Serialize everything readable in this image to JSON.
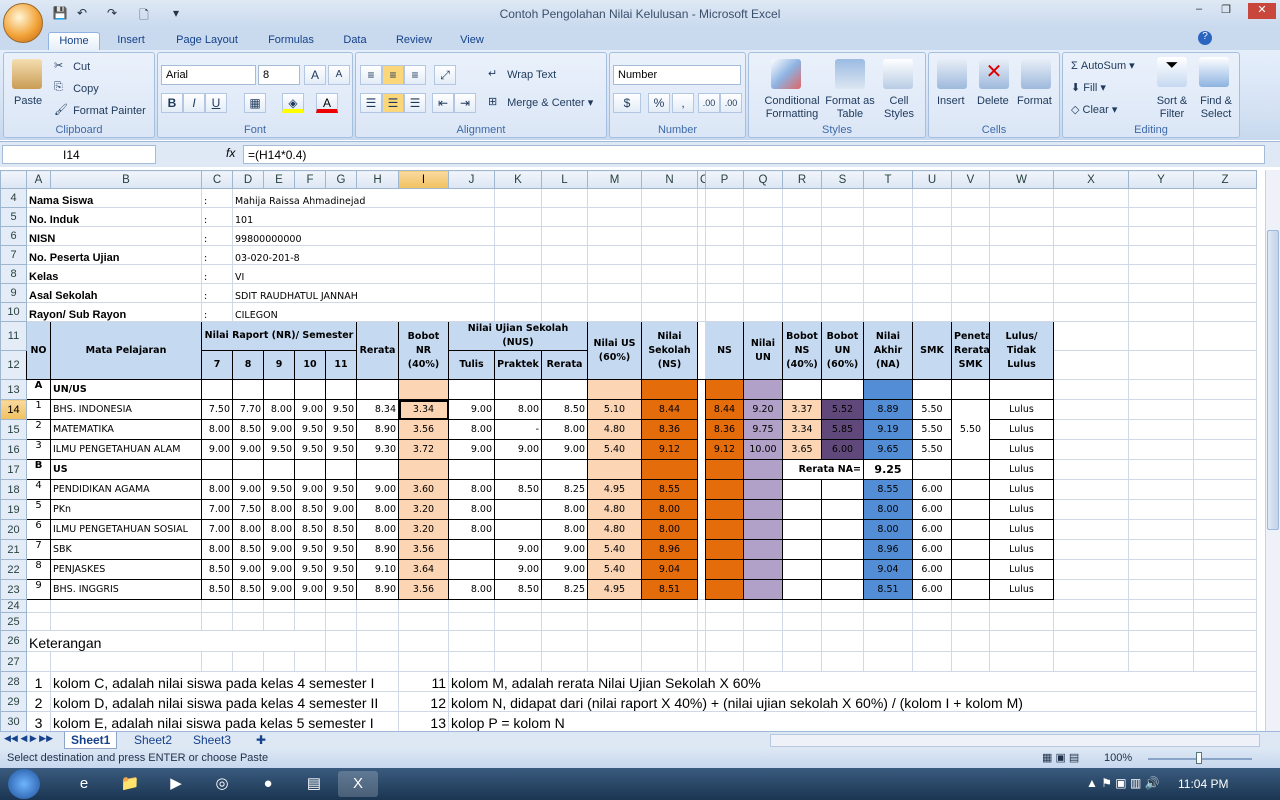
{
  "window": {
    "title": "Contoh Pengolahan Nilai Kelulusan - Microsoft Excel"
  },
  "ribbon_tabs": [
    "Home",
    "Insert",
    "Page Layout",
    "Formulas",
    "Data",
    "Review",
    "View"
  ],
  "ribbon": {
    "clipboard": {
      "label": "Clipboard",
      "paste": "Paste",
      "cut": "Cut",
      "copy": "Copy",
      "format_painter": "Format Painter"
    },
    "font": {
      "label": "Font",
      "name": "Arial",
      "size": "8",
      "bold": "B",
      "italic": "I",
      "underline": "U"
    },
    "alignment": {
      "label": "Alignment",
      "wrap": "Wrap Text",
      "merge": "Merge & Center"
    },
    "number": {
      "label": "Number",
      "format": "Number",
      "currency": "$",
      "percent": "%",
      "comma": ",",
      "inc": ".00",
      "dec": ".00"
    },
    "styles": {
      "label": "Styles",
      "conditional": "Conditional Formatting",
      "format_table": "Format as Table",
      "cell_styles": "Cell Styles"
    },
    "cells": {
      "label": "Cells",
      "insert": "Insert",
      "delete": "Delete",
      "format": "Format"
    },
    "editing": {
      "label": "Editing",
      "autosum": "AutoSum",
      "fill": "Fill",
      "clear": "Clear",
      "sort": "Sort & Filter",
      "find": "Find & Select"
    }
  },
  "formula_bar": {
    "name_box": "I14",
    "fx": "fx",
    "formula": "=(H14*0.4)"
  },
  "columns": [
    "A",
    "B",
    "C",
    "D",
    "E",
    "F",
    "G",
    "H",
    "I",
    "J",
    "K",
    "L",
    "M",
    "N",
    "O",
    "P",
    "Q",
    "R",
    "S",
    "T",
    "U",
    "V",
    "W",
    "X",
    "Y",
    "Z"
  ],
  "selected_cell": {
    "column": "I",
    "row": "14"
  },
  "info": [
    {
      "row": "4",
      "label": "Nama Siswa",
      "sep": ":",
      "value": "Mahija Raissa Ahmadinejad"
    },
    {
      "row": "5",
      "label": "No. Induk",
      "sep": ":",
      "value": "101"
    },
    {
      "row": "6",
      "label": "NISN",
      "sep": ":",
      "value": "99800000000"
    },
    {
      "row": "7",
      "label": "No. Peserta Ujian",
      "sep": ":",
      "value": "03-020-201-8"
    },
    {
      "row": "8",
      "label": "Kelas",
      "sep": ":",
      "value": "VI"
    },
    {
      "row": "9",
      "label": "Asal Sekolah",
      "sep": ":",
      "value": "SDIT RAUDHATUL JANNAH"
    },
    {
      "row": "10",
      "label": "Rayon/ Sub Rayon",
      "sep": ":",
      "value": "CILEGON"
    }
  ],
  "table_header": {
    "rows": [
      "11",
      "12"
    ],
    "no": "NO",
    "subject": "Mata Pelajaran",
    "nr": "Nilai Raport (NR)/ Semester",
    "semesters": [
      "7",
      "8",
      "9",
      "10",
      "11"
    ],
    "rerata": "Rerata",
    "bobot_nr": "Bobot NR (40%)",
    "nus": "Nilai Ujian Sekolah (NUS)",
    "nus_cols": [
      "Tulis",
      "Praktek",
      "Rerata"
    ],
    "nilai_us": "Nilai US (60%)",
    "nilai_sekolah": "Nilai Sekolah (NS)",
    "ns": "NS",
    "nilai_un": "Nilai UN",
    "bobot_ns": "Bobot NS (40%)",
    "bobot_un": "Bobot UN (60%)",
    "nilai_akhir": "Nilai Akhir (NA)",
    "smk": "SMK",
    "penetapan": "Penetapan Rerata SMK",
    "lulus": "Lulus/ Tidak Lulus"
  },
  "table_rows": [
    {
      "row": "13",
      "no": "A",
      "name": "UN/US",
      "section": true,
      "v": [
        "",
        "",
        "",
        "",
        "",
        "",
        "",
        "",
        "",
        "",
        "",
        "",
        "",
        "",
        "",
        "",
        "",
        "",
        "",
        "",
        ""
      ]
    },
    {
      "row": "14",
      "no": "1",
      "name": "BHS. INDONESIA",
      "v": [
        "7.50",
        "7.70",
        "8.00",
        "9.00",
        "9.50",
        "8.34",
        "3.34",
        "9.00",
        "8.00",
        "8.50",
        "5.10",
        "8.44",
        "",
        "8.44",
        "9.20",
        "3.37",
        "5.52",
        "8.89",
        "5.50",
        "5.50",
        "Lulus"
      ]
    },
    {
      "row": "15",
      "no": "2",
      "name": "MATEMATIKA",
      "v": [
        "8.00",
        "8.50",
        "9.00",
        "9.50",
        "9.50",
        "8.90",
        "3.56",
        "8.00",
        "-",
        "8.00",
        "4.80",
        "8.36",
        "",
        "8.36",
        "9.75",
        "3.34",
        "5.85",
        "9.19",
        "5.50",
        "",
        "Lulus"
      ]
    },
    {
      "row": "16",
      "no": "3",
      "name": "ILMU PENGETAHUAN ALAM",
      "v": [
        "9.00",
        "9.00",
        "9.50",
        "9.50",
        "9.50",
        "9.30",
        "3.72",
        "9.00",
        "9.00",
        "9.00",
        "5.40",
        "9.12",
        "",
        "9.12",
        "10.00",
        "3.65",
        "6.00",
        "9.65",
        "5.50",
        "",
        "Lulus"
      ]
    },
    {
      "row": "17",
      "no": "B",
      "name": "US",
      "section": true,
      "v": [
        "",
        "",
        "",
        "",
        "",
        "",
        "",
        "",
        "",
        "",
        "",
        "",
        "",
        "",
        "",
        "Rerata NA=",
        "",
        "9.25",
        "",
        "",
        "Lulus"
      ]
    },
    {
      "row": "18",
      "no": "4",
      "name": "PENDIDIKAN AGAMA",
      "v": [
        "8.00",
        "9.00",
        "9.50",
        "9.00",
        "9.50",
        "9.00",
        "3.60",
        "8.00",
        "8.50",
        "8.25",
        "4.95",
        "8.55",
        "",
        "",
        "",
        "",
        "",
        "8.55",
        "6.00",
        "",
        "Lulus"
      ]
    },
    {
      "row": "19",
      "no": "5",
      "name": "PKn",
      "v": [
        "7.00",
        "7.50",
        "8.00",
        "8.50",
        "9.00",
        "8.00",
        "3.20",
        "8.00",
        "",
        "8.00",
        "4.80",
        "8.00",
        "",
        "",
        "",
        "",
        "",
        "8.00",
        "6.00",
        "",
        "Lulus"
      ]
    },
    {
      "row": "20",
      "no": "6",
      "name": "ILMU PENGETAHUAN SOSIAL",
      "v": [
        "7.00",
        "8.00",
        "8.00",
        "8.50",
        "8.50",
        "8.00",
        "3.20",
        "8.00",
        "",
        "8.00",
        "4.80",
        "8.00",
        "",
        "",
        "",
        "",
        "",
        "8.00",
        "6.00",
        "",
        "Lulus"
      ]
    },
    {
      "row": "21",
      "no": "7",
      "name": "SBK",
      "v": [
        "8.00",
        "8.50",
        "9.00",
        "9.50",
        "9.50",
        "8.90",
        "3.56",
        "",
        "9.00",
        "9.00",
        "5.40",
        "8.96",
        "",
        "",
        "",
        "",
        "",
        "8.96",
        "6.00",
        "",
        "Lulus"
      ]
    },
    {
      "row": "22",
      "no": "8",
      "name": "PENJASKES",
      "v": [
        "8.50",
        "9.00",
        "9.00",
        "9.50",
        "9.50",
        "9.10",
        "3.64",
        "",
        "9.00",
        "9.00",
        "5.40",
        "9.04",
        "",
        "",
        "",
        "",
        "",
        "9.04",
        "6.00",
        "",
        "Lulus"
      ]
    },
    {
      "row": "23",
      "no": "9",
      "name": "BHS. INGGRIS",
      "v": [
        "8.50",
        "8.50",
        "9.00",
        "9.00",
        "9.50",
        "8.90",
        "3.56",
        "8.00",
        "8.50",
        "8.25",
        "4.95",
        "8.51",
        "",
        "",
        "",
        "",
        "",
        "8.51",
        "6.00",
        "",
        "Lulus"
      ]
    }
  ],
  "empty_rows": [
    "24",
    "25",
    "27"
  ],
  "keterangan": {
    "row": "26",
    "label": "Keterangan"
  },
  "notes": [
    {
      "row": "28",
      "n1": "1",
      "t1": "kolom C, adalah nilai siswa pada kelas 4 semester I",
      "n2": "11",
      "t2": "kolom M, adalah rerata Nilai Ujian Sekolah X 60%"
    },
    {
      "row": "29",
      "n1": "2",
      "t1": "kolom D, adalah nilai siswa pada kelas 4 semester II",
      "n2": "12",
      "t2": "kolom N, didapat dari (nilai raport X 40%) + (nilai ujian sekolah X 60%) / (kolom I + kolom M)"
    },
    {
      "row": "30",
      "n1": "3",
      "t1": "kolom E, adalah nilai siswa pada kelas 5 semester I",
      "n2": "13",
      "t2": "kolop P = kolom N"
    }
  ],
  "sheets": [
    "Sheet1",
    "Sheet2",
    "Sheet3"
  ],
  "status": {
    "message": "Select destination and press ENTER or choose Paste",
    "zoom": "100%"
  },
  "taskbar": {
    "time": "11:04 PM"
  },
  "colors": {
    "peach": "#fcd5b4",
    "orange": "#e46c0a",
    "lavender": "#b1a0c7",
    "dark_purple": "#60497a",
    "blue": "#538dd5",
    "header_blue": "#c5d9f1"
  }
}
